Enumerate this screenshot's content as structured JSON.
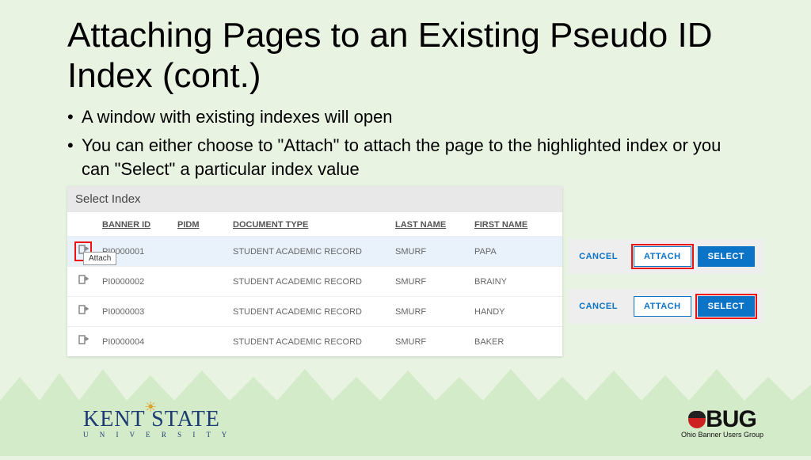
{
  "title": "Attaching Pages to an Existing Pseudo ID Index (cont.)",
  "bullets": [
    "A window with existing indexes will open",
    "You can either choose to \"Attach\" to attach the page to the highlighted index or you can \"Select\" a particular index value"
  ],
  "panel": {
    "heading": "Select Index",
    "columns": {
      "banner_id": "BANNER ID",
      "pidm": "PIDM",
      "doc_type": "DOCUMENT TYPE",
      "last_name": "LAST NAME",
      "first_name": "FIRST NAME"
    },
    "rows": [
      {
        "banner_id": "PI0000001",
        "pidm": "",
        "doc_type": "STUDENT ACADEMIC RECORD",
        "last_name": "SMURF",
        "first_name": "PAPA",
        "selected": true,
        "icon_highlighted": true
      },
      {
        "banner_id": "PI0000002",
        "pidm": "",
        "doc_type": "STUDENT ACADEMIC RECORD",
        "last_name": "SMURF",
        "first_name": "BRAINY",
        "selected": false,
        "icon_highlighted": false
      },
      {
        "banner_id": "PI0000003",
        "pidm": "",
        "doc_type": "STUDENT ACADEMIC RECORD",
        "last_name": "SMURF",
        "first_name": "HANDY",
        "selected": false,
        "icon_highlighted": false
      },
      {
        "banner_id": "PI0000004",
        "pidm": "",
        "doc_type": "STUDENT ACADEMIC RECORD",
        "last_name": "SMURF",
        "first_name": "BAKER",
        "selected": false,
        "icon_highlighted": false
      }
    ],
    "tooltip": "Attach"
  },
  "buttons": {
    "cancel": "CANCEL",
    "attach": "ATTACH",
    "select": "SELECT"
  },
  "logos": {
    "left_main": "KENT STATE",
    "left_sub": "U N I V E R S I T Y",
    "right_main_prefix": "",
    "right_main": "BUG",
    "right_sub": "Ohio Banner Users Group"
  }
}
